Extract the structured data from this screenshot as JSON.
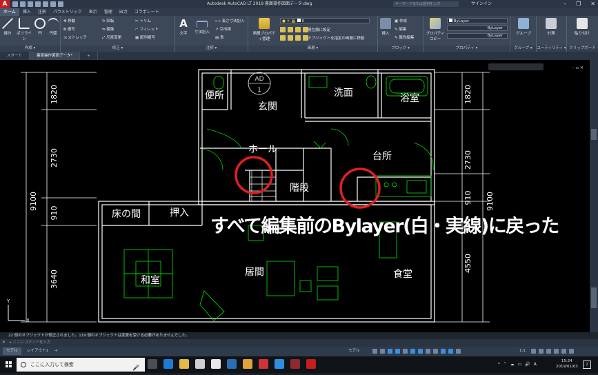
{
  "window": {
    "title": "Autodesk AutoCAD LT 2019   裏面操作図面データ.dwg",
    "search_placeholder": "キーワードまたは語句を入力",
    "signin": "サインイン"
  },
  "ribbon_tabs": [
    "ホーム",
    "挿入",
    "注釈",
    "パラメトリック",
    "表示",
    "管理",
    "出力",
    "コラボレート"
  ],
  "panels": {
    "draw": {
      "title": "作成 ▾",
      "tools": [
        "線分",
        "ポリライン",
        "円",
        "円弧"
      ]
    },
    "modify": {
      "title": "修正 ▾",
      "tools": [
        "移動",
        "回転",
        "トリム",
        "複写",
        "鏡像",
        "フィレット",
        "ストレッチ",
        "尺度変更",
        "配列複写"
      ]
    },
    "annotation": {
      "title": "注釈 ▾",
      "tools": [
        "文字",
        "寸法記入",
        "長さ寸法記入",
        "引出線",
        "表"
      ]
    },
    "layers": {
      "title": "画層 ▾",
      "tools": [
        "画層プロパティ管理",
        "現在層に設定",
        "オブジェクトを指定の画層に移動"
      ],
      "current_layer": "0"
    },
    "block": {
      "title": "ブロック ▾",
      "tools": [
        "挿入",
        "作成",
        "編集",
        "属性編集"
      ]
    },
    "properties": {
      "title": "プロパティ ▾",
      "tools": [
        "プロパティコピー"
      ],
      "color": "ByLayer",
      "linetype": "ByLayer",
      "lineweight": "ByLayer"
    },
    "groups": {
      "title": "グループ ▾",
      "tools": [
        "グループ"
      ]
    },
    "utilities": {
      "title": "ユーティリティ ▾",
      "tools": [
        "計測"
      ]
    },
    "clipboard": {
      "title": "クリップボード",
      "tools": [
        "貼り付け"
      ]
    }
  },
  "doc_tabs": [
    "スタート",
    "裏面操作図面データ*",
    "+"
  ],
  "drawing": {
    "rooms": [
      "便所",
      "玄関",
      "洗面",
      "浴室",
      "ホール",
      "台所",
      "階段",
      "床の間",
      "押入",
      "和室",
      "居間",
      "食堂"
    ],
    "left_dims": [
      "1820",
      "2730",
      "910",
      "3640"
    ],
    "left_total": "9100",
    "right_dims": [
      "1820",
      "2730",
      "910",
      "4550"
    ],
    "right_total": "9100",
    "ad_label": "AD",
    "ad_number": "1"
  },
  "caption": "すべて編集前のBylayer(白・実線)に戻った",
  "command": {
    "history": "22 個のオブジェクトが修正されました。119 個のオブジェクトは変更を受ける必要がありませんでした。",
    "placeholder": "ここにコマンドを入力"
  },
  "layout_tabs": [
    "モデル",
    "レイアウト1",
    "+"
  ],
  "status": {
    "model": "モデル",
    "scale": "1:1"
  },
  "taskbar": {
    "search_placeholder": "ここに入力して検索",
    "time": "15:24",
    "date": "2019/01/03",
    "notifications": "2",
    "tray_a": "A"
  },
  "colors": {
    "canvas": "#000000",
    "wall": "#ffffff",
    "furniture": "#00d000",
    "highlight_circle": "#e02020",
    "dim_text": "#ffffff"
  }
}
